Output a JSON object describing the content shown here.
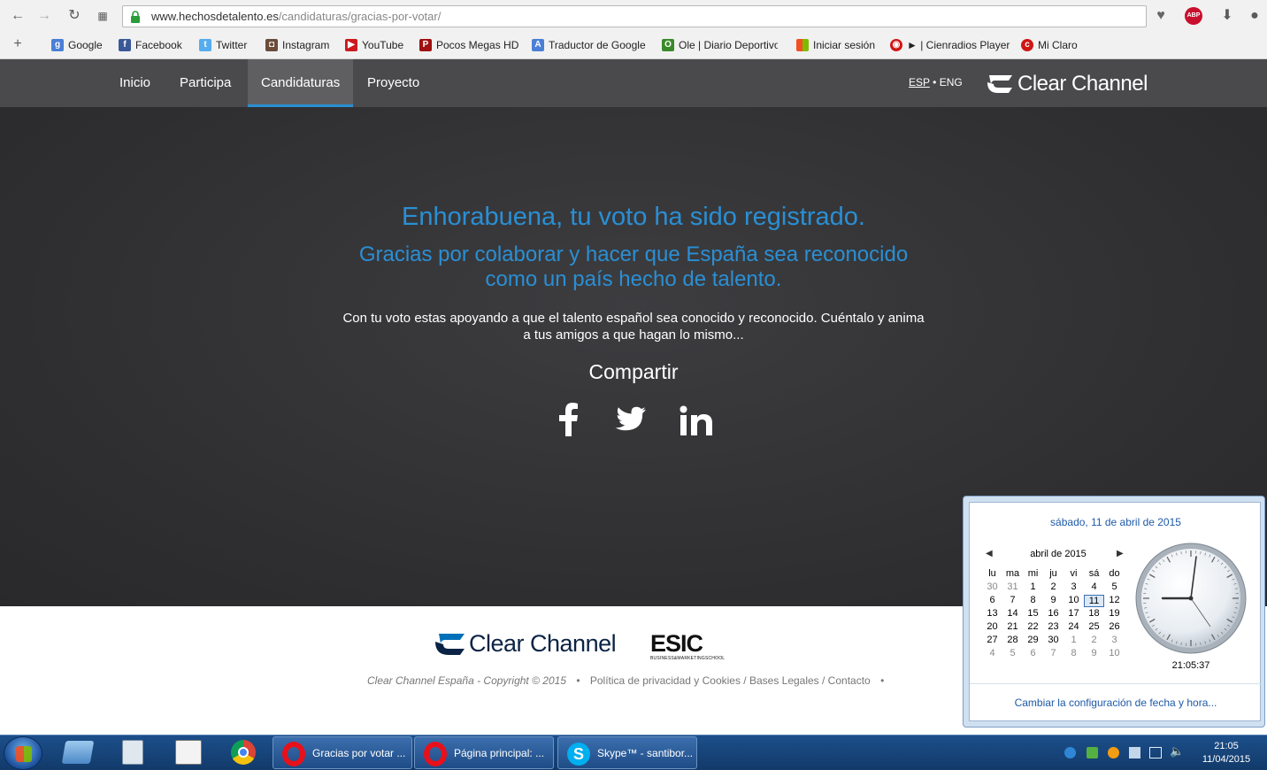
{
  "browser": {
    "url_host": "www.hechosdetalento.es",
    "url_path": "/candidaturas/gracias-por-votar/",
    "bookmarks": [
      "Google",
      "Facebook",
      "Twitter",
      "Instagram",
      "YouTube",
      "Pocos Megas HD",
      "Traductor de Google",
      "Ole | Diario Deportivo",
      "Iniciar sesión",
      "► | Cienradios Player",
      "Mi Claro"
    ],
    "abp_label": "ABP"
  },
  "site": {
    "nav": [
      "Inicio",
      "Participa",
      "Candidaturas",
      "Proyecto"
    ],
    "active_nav": "Candidaturas",
    "lang_esp": "ESP",
    "lang_sep": "•",
    "lang_eng": "ENG",
    "brand": "Clear Channel",
    "accent_color": "#2a8fd4"
  },
  "hero": {
    "headline": "Enhorabuena, tu voto ha sido registrado.",
    "subline1": "Gracias por colaborar y hacer que España sea reconocido",
    "subline2": "como un país hecho de talento.",
    "body1": "Con tu voto estas apoyando a que el talento español sea conocido y reconocido. Cuéntalo y anima",
    "body2": "a tus amigos a que hagan lo mismo...",
    "share_label": "Compartir",
    "share_icons": [
      "facebook-icon",
      "twitter-icon",
      "linkedin-icon"
    ]
  },
  "footer": {
    "brand": "Clear Channel",
    "esic_logo": "ESIC",
    "esic_sub": "BUSINESS&MARKETINGSCHOOL",
    "copyright": "Clear Channel España - Copyright © 2015",
    "bullet": "•",
    "links": "Política de privacidad y Cookies / Bases Legales / Contacto"
  },
  "taskbar": {
    "windows": [
      "Gracias por votar ...",
      "Página principal: ...",
      "Skype™ - santibor..."
    ],
    "clock_time": "21:05",
    "clock_date": "11/04/2015"
  },
  "calendar": {
    "long_date": "sábado, 11 de abril de 2015",
    "month_label": "abril de 2015",
    "weekdays": [
      "lu",
      "ma",
      "mi",
      "ju",
      "vi",
      "sá",
      "do"
    ],
    "weeks": [
      [
        "30",
        "31",
        "1",
        "2",
        "3",
        "4",
        "5"
      ],
      [
        "6",
        "7",
        "8",
        "9",
        "10",
        "11",
        "12"
      ],
      [
        "13",
        "14",
        "15",
        "16",
        "17",
        "18",
        "19"
      ],
      [
        "20",
        "21",
        "22",
        "23",
        "24",
        "25",
        "26"
      ],
      [
        "27",
        "28",
        "29",
        "30",
        "1",
        "2",
        "3"
      ],
      [
        "4",
        "5",
        "6",
        "7",
        "8",
        "9",
        "10"
      ]
    ],
    "today": "11",
    "digital_time": "21:05:37",
    "settings_link": "Cambiar la configuración de fecha y hora..."
  }
}
